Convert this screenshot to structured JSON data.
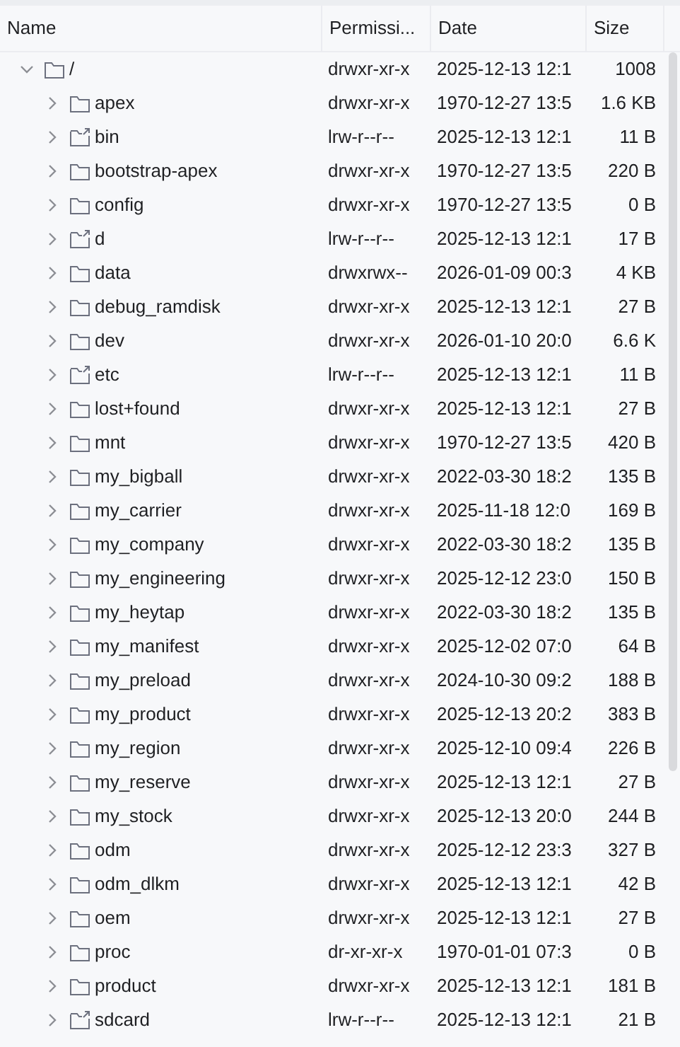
{
  "columns": [
    {
      "label": "Name"
    },
    {
      "label": "Permissi..."
    },
    {
      "label": "Date"
    },
    {
      "label": "Size"
    }
  ],
  "tree": [
    {
      "name": "/",
      "kind": "folder",
      "expanded": true,
      "permissions": "drwxr-xr-x",
      "date": "2025-12-13 12:1",
      "size": "1008",
      "children": [
        {
          "name": "apex",
          "kind": "folder",
          "expanded": false,
          "permissions": "drwxr-xr-x",
          "date": "1970-12-27 13:5",
          "size": "1.6 KB"
        },
        {
          "name": "bin",
          "kind": "link",
          "expanded": false,
          "permissions": "lrw-r--r--",
          "date": "2025-12-13 12:1",
          "size": "11 B"
        },
        {
          "name": "bootstrap-apex",
          "kind": "folder",
          "expanded": false,
          "permissions": "drwxr-xr-x",
          "date": "1970-12-27 13:5",
          "size": "220 B"
        },
        {
          "name": "config",
          "kind": "folder",
          "expanded": false,
          "permissions": "drwxr-xr-x",
          "date": "1970-12-27 13:5",
          "size": "0 B"
        },
        {
          "name": "d",
          "kind": "link",
          "expanded": false,
          "permissions": "lrw-r--r--",
          "date": "2025-12-13 12:1",
          "size": "17 B"
        },
        {
          "name": "data",
          "kind": "folder",
          "expanded": false,
          "permissions": "drwxrwx--",
          "date": "2026-01-09 00:3",
          "size": "4 KB"
        },
        {
          "name": "debug_ramdisk",
          "kind": "folder",
          "expanded": false,
          "permissions": "drwxr-xr-x",
          "date": "2025-12-13 12:1",
          "size": "27 B"
        },
        {
          "name": "dev",
          "kind": "folder",
          "expanded": false,
          "permissions": "drwxr-xr-x",
          "date": "2026-01-10 20:0",
          "size": "6.6 K"
        },
        {
          "name": "etc",
          "kind": "link",
          "expanded": false,
          "permissions": "lrw-r--r--",
          "date": "2025-12-13 12:1",
          "size": "11 B"
        },
        {
          "name": "lost+found",
          "kind": "folder",
          "expanded": false,
          "permissions": "drwxr-xr-x",
          "date": "2025-12-13 12:1",
          "size": "27 B"
        },
        {
          "name": "mnt",
          "kind": "folder",
          "expanded": false,
          "permissions": "drwxr-xr-x",
          "date": "1970-12-27 13:5",
          "size": "420 B"
        },
        {
          "name": "my_bigball",
          "kind": "folder",
          "expanded": false,
          "permissions": "drwxr-xr-x",
          "date": "2022-03-30 18:2",
          "size": "135 B"
        },
        {
          "name": "my_carrier",
          "kind": "folder",
          "expanded": false,
          "permissions": "drwxr-xr-x",
          "date": "2025-11-18 12:0",
          "size": "169 B"
        },
        {
          "name": "my_company",
          "kind": "folder",
          "expanded": false,
          "permissions": "drwxr-xr-x",
          "date": "2022-03-30 18:2",
          "size": "135 B"
        },
        {
          "name": "my_engineering",
          "kind": "folder",
          "expanded": false,
          "permissions": "drwxr-xr-x",
          "date": "2025-12-12 23:0",
          "size": "150 B"
        },
        {
          "name": "my_heytap",
          "kind": "folder",
          "expanded": false,
          "permissions": "drwxr-xr-x",
          "date": "2022-03-30 18:2",
          "size": "135 B"
        },
        {
          "name": "my_manifest",
          "kind": "folder",
          "expanded": false,
          "permissions": "drwxr-xr-x",
          "date": "2025-12-02 07:0",
          "size": "64 B"
        },
        {
          "name": "my_preload",
          "kind": "folder",
          "expanded": false,
          "permissions": "drwxr-xr-x",
          "date": "2024-10-30 09:2",
          "size": "188 B"
        },
        {
          "name": "my_product",
          "kind": "folder",
          "expanded": false,
          "permissions": "drwxr-xr-x",
          "date": "2025-12-13 20:2",
          "size": "383 B"
        },
        {
          "name": "my_region",
          "kind": "folder",
          "expanded": false,
          "permissions": "drwxr-xr-x",
          "date": "2025-12-10 09:4",
          "size": "226 B"
        },
        {
          "name": "my_reserve",
          "kind": "folder",
          "expanded": false,
          "permissions": "drwxr-xr-x",
          "date": "2025-12-13 12:1",
          "size": "27 B"
        },
        {
          "name": "my_stock",
          "kind": "folder",
          "expanded": false,
          "permissions": "drwxr-xr-x",
          "date": "2025-12-13 20:0",
          "size": "244 B"
        },
        {
          "name": "odm",
          "kind": "folder",
          "expanded": false,
          "permissions": "drwxr-xr-x",
          "date": "2025-12-12 23:3",
          "size": "327 B"
        },
        {
          "name": "odm_dlkm",
          "kind": "folder",
          "expanded": false,
          "permissions": "drwxr-xr-x",
          "date": "2025-12-13 12:1",
          "size": "42 B"
        },
        {
          "name": "oem",
          "kind": "folder",
          "expanded": false,
          "permissions": "drwxr-xr-x",
          "date": "2025-12-13 12:1",
          "size": "27 B"
        },
        {
          "name": "proc",
          "kind": "folder",
          "expanded": false,
          "permissions": "dr-xr-xr-x",
          "date": "1970-01-01 07:3",
          "size": "0 B"
        },
        {
          "name": "product",
          "kind": "folder",
          "expanded": false,
          "permissions": "drwxr-xr-x",
          "date": "2025-12-13 12:1",
          "size": "181 B"
        },
        {
          "name": "sdcard",
          "kind": "link",
          "expanded": false,
          "permissions": "lrw-r--r--",
          "date": "2025-12-13 12:1",
          "size": "21 B"
        }
      ]
    }
  ]
}
